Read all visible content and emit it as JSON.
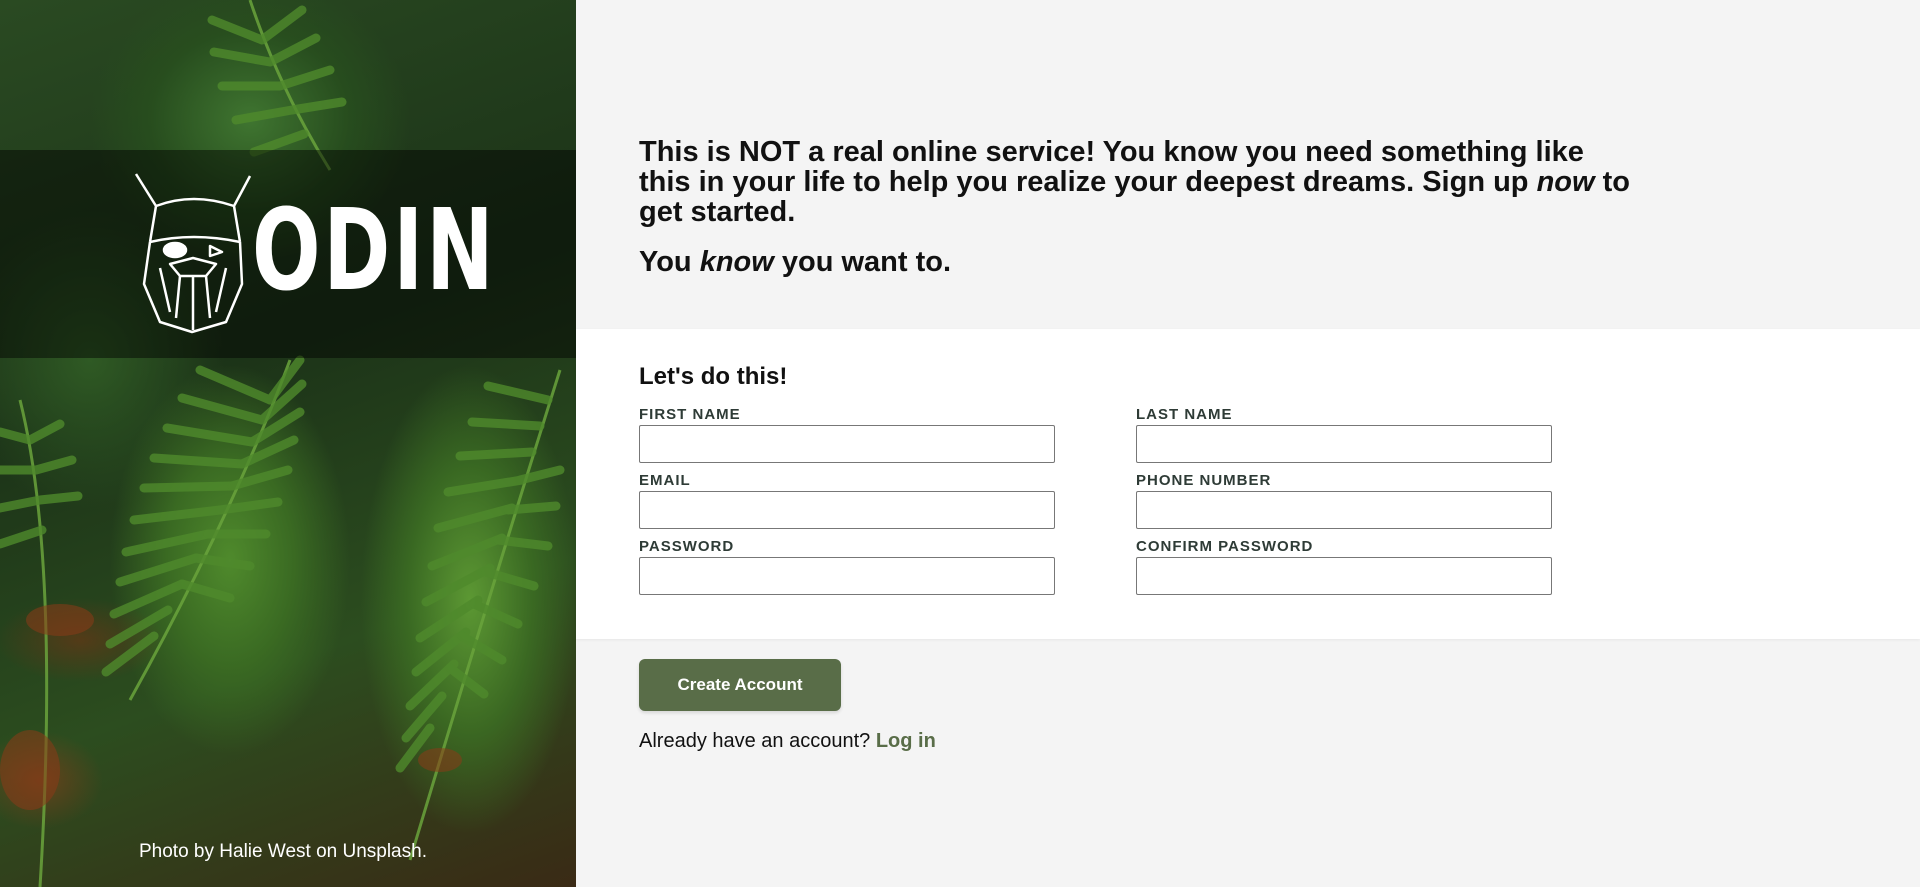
{
  "side": {
    "brand": "ODIN",
    "logo_icon": "odin-viking-head-icon",
    "photo_credit": "Photo by Halie West on Unsplash."
  },
  "intro": {
    "line1_pre": "This is NOT a real online service! You know you need something like this in your life to help you realize your deepest dreams. Sign up ",
    "line1_em": "now",
    "line1_post": " to get started.",
    "line2_pre": "You ",
    "line2_em": "know",
    "line2_post": " you want to."
  },
  "form": {
    "title": "Let's do this!",
    "fields": {
      "first_name": {
        "label": "FIRST NAME",
        "value": ""
      },
      "last_name": {
        "label": "LAST NAME",
        "value": ""
      },
      "email": {
        "label": "EMAIL",
        "value": ""
      },
      "phone": {
        "label": "PHONE NUMBER",
        "value": ""
      },
      "password": {
        "label": "PASSWORD",
        "value": ""
      },
      "confirm_password": {
        "label": "CONFIRM PASSWORD",
        "value": ""
      }
    }
  },
  "actions": {
    "create_label": "Create Account",
    "login_prompt": "Already have an account? ",
    "login_link": "Log in"
  },
  "colors": {
    "accent": "#596d48",
    "page_bg": "#f4f4f4",
    "card_bg": "#ffffff"
  }
}
